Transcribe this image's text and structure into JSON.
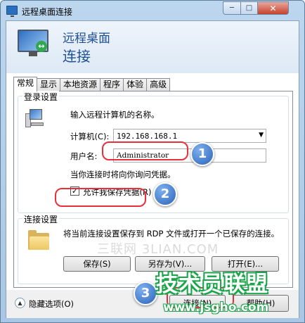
{
  "window": {
    "title": "远程桌面连接",
    "minimize_glyph": "─",
    "maximize_glyph": "□",
    "close_glyph": "✕"
  },
  "banner": {
    "line1": "远程桌面",
    "line2": "连接",
    "icon": "remote-desktop-monitor-icon"
  },
  "tabs": [
    {
      "label": "常规",
      "active": true
    },
    {
      "label": "显示",
      "active": false
    },
    {
      "label": "本地资源",
      "active": false
    },
    {
      "label": "程序",
      "active": false
    },
    {
      "label": "体验",
      "active": false
    },
    {
      "label": "高级",
      "active": false
    }
  ],
  "login": {
    "legend": "登录设置",
    "instruction": "输入远程计算机的名称。",
    "computer_label": "计算机(C):",
    "computer_value": "192.168.168.1",
    "user_label": "用户名:",
    "user_value": "Administrator",
    "hint": "当你连接时将向你询问凭据。",
    "remember_label": "允许我保存凭据(R)",
    "remember_checked": true,
    "check_glyph": "✓"
  },
  "connection": {
    "legend": "连接设置",
    "description": "将当前连接设置保存到 RDP 文件或打开一个已保存的连接。",
    "save_label": "保存(S)",
    "saveas_label": "另存为(V)...",
    "open_label": "打开(E)..."
  },
  "footer": {
    "hide_options_label": "隐藏选项(O)",
    "hide_glyph": "▲",
    "connect_label": "连接(N)",
    "help_label": "帮助(H)"
  },
  "annotations": {
    "step1": "1",
    "step2": "2",
    "step3": "3",
    "accent_color": "#e8303c",
    "badge_color": "#2a63b8"
  },
  "watermark": {
    "cn_text": "三联网 3LIAN.COM",
    "brand_text": "技术员联盟",
    "brand_url": "www.jsgho.com"
  }
}
